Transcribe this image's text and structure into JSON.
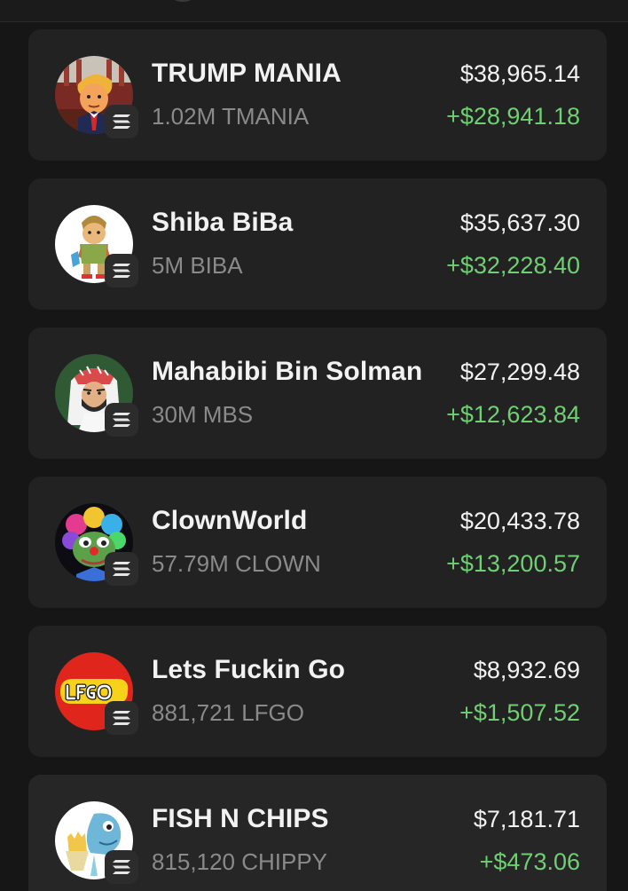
{
  "tokens": [
    {
      "name": "TRUMP MANIA",
      "holding": "1.02M TMANIA",
      "value": "$38,965.14",
      "change": "+$28,941.18",
      "avatar_icon": "trump-cartoon-icon"
    },
    {
      "name": "Shiba BiBa",
      "holding": "5M BIBA",
      "value": "$35,637.30",
      "change": "+$32,228.40",
      "avatar_icon": "shiba-biba-icon"
    },
    {
      "name": "Mahabibi Bin Solman",
      "holding": "30M MBS",
      "value": "$27,299.48",
      "change": "+$12,623.84",
      "avatar_icon": "sheikh-cartoon-icon"
    },
    {
      "name": "ClownWorld",
      "holding": "57.79M CLOWN",
      "value": "$20,433.78",
      "change": "+$13,200.57",
      "avatar_icon": "clown-pepe-icon"
    },
    {
      "name": "Lets Fuckin Go",
      "holding": "881,721 LFGO",
      "value": "$8,932.69",
      "change": "+$1,507.52",
      "avatar_icon": "lfgo-logo-icon"
    },
    {
      "name": "FISH N CHIPS",
      "holding": "815,120 CHIPPY",
      "value": "$7,181.71",
      "change": "+$473.06",
      "avatar_icon": "fish-chips-icon"
    }
  ],
  "chain_badge_icon": "solana-icon",
  "colors": {
    "background": "#161616",
    "card": "#222222",
    "positive": "#6fcf72",
    "primary_text": "#f2f2f2",
    "secondary_text": "#8a8a8a"
  }
}
